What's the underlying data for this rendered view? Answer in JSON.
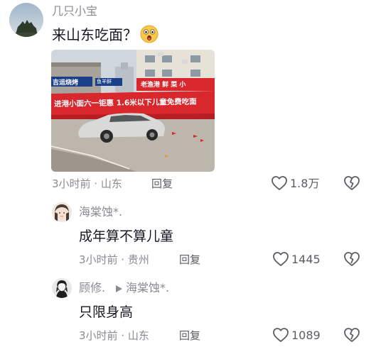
{
  "comments": [
    {
      "user": "几只小宝",
      "text": "来山东吃面？",
      "emoji": "surprised-face-emoji",
      "meta": "3小时前 · 山东",
      "reply_label": "回复",
      "likes": "1.8万",
      "photo": {
        "signs": {
          "banner": "进港小面六一钜惠  1.6米以下儿童免费吃面",
          "shop_left": "吉运烧烤",
          "shop_right": "老渔港 鲜 菜 小",
          "small": "鱼羊鲜"
        }
      }
    },
    {
      "user": "海棠蚀*.",
      "text": "成年算不算儿童",
      "meta": "3小时前 · 贵州",
      "reply_label": "回复",
      "likes": "1445"
    },
    {
      "user": "顾修.",
      "reply_to": "海棠蚀*.",
      "text": "只限身高",
      "meta": "3小时前 · 山东",
      "reply_label": "回复",
      "likes": "1089"
    }
  ],
  "icons": {
    "like": "heart-outline-icon",
    "dislike": "broken-heart-icon",
    "reply_arrow": "play-triangle-icon"
  },
  "colors": {
    "text": "#161823",
    "secondary": "#8a8b91",
    "banner_red": "#d8272d"
  }
}
